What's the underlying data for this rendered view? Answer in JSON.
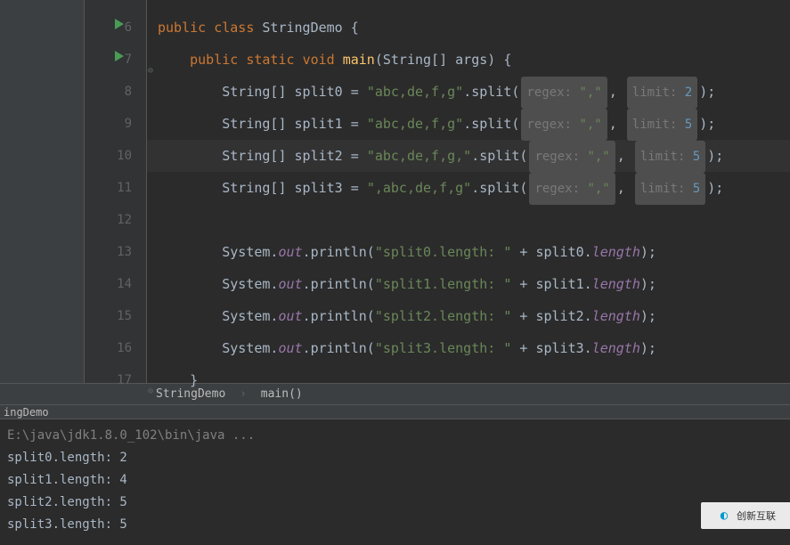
{
  "editor": {
    "lines": [
      {
        "num": "6",
        "run": true
      },
      {
        "num": "7",
        "run": true,
        "fold": true
      },
      {
        "num": "8"
      },
      {
        "num": "9"
      },
      {
        "num": "10",
        "highlighted": true
      },
      {
        "num": "11"
      },
      {
        "num": "12"
      },
      {
        "num": "13"
      },
      {
        "num": "14"
      },
      {
        "num": "15"
      },
      {
        "num": "16"
      },
      {
        "num": "17",
        "fold": true
      }
    ],
    "code": {
      "l6": {
        "public": "public",
        "class": "class",
        "name": "StringDemo",
        "brace": "{"
      },
      "l7": {
        "public": "public",
        "static": "static",
        "void": "void",
        "main": "main",
        "params": "(String[] args)",
        "brace": "{"
      },
      "l8": {
        "decl": "String[] split0 = ",
        "str": "\"abc,de,f,g\"",
        "split": ".split(",
        "regex": "regex:",
        "regexval": " \",\"",
        "comma": ",",
        "limit": "limit:",
        "limitval": " 2",
        "end": ");"
      },
      "l9": {
        "decl": "String[] split1 = ",
        "str": "\"abc,de,f,g\"",
        "split": ".split(",
        "regex": "regex:",
        "regexval": " \",\"",
        "comma": ",",
        "limit": "limit:",
        "limitval": " 5",
        "end": ");"
      },
      "l10": {
        "decl": "String[] split2 = ",
        "str": "\"abc,de,f,g,\"",
        "split": ".split(",
        "regex": "regex:",
        "regexval": " \",\"",
        "comma": ",",
        "limit": "limit:",
        "limitval": " 5",
        "end": ");"
      },
      "l11": {
        "decl": "String[] split3 = ",
        "str": "\",abc,de,f,g\"",
        "split": ".split(",
        "regex": "regex:",
        "regexval": " \",\"",
        "comma": ",",
        "limit": "limit:",
        "limitval": " 5",
        "end": ");"
      },
      "l13": {
        "sys": "System.",
        "out": "out",
        "println": ".println(",
        "str": "\"split0.length: \"",
        "plus": " + split0.",
        "len": "length",
        "end": ");"
      },
      "l14": {
        "sys": "System.",
        "out": "out",
        "println": ".println(",
        "str": "\"split1.length: \"",
        "plus": " + split1.",
        "len": "length",
        "end": ");"
      },
      "l15": {
        "sys": "System.",
        "out": "out",
        "println": ".println(",
        "str": "\"split2.length: \"",
        "plus": " + split2.",
        "len": "length",
        "end": ");"
      },
      "l16": {
        "sys": "System.",
        "out": "out",
        "println": ".println(",
        "str": "\"split3.length: \"",
        "plus": " + split3.",
        "len": "length",
        "end": ");"
      },
      "l17": {
        "brace": "}"
      }
    }
  },
  "breadcrumb": {
    "class": "StringDemo",
    "method": "main()"
  },
  "run": {
    "tab": "ingDemo",
    "cmd": "E:\\java\\jdk1.8.0_102\\bin\\java ...",
    "out1": "split0.length: 2",
    "out2": "split1.length: 4",
    "out3": "split2.length: 5",
    "out4": "split3.length: 5"
  },
  "watermark": {
    "text": "创新互联"
  }
}
